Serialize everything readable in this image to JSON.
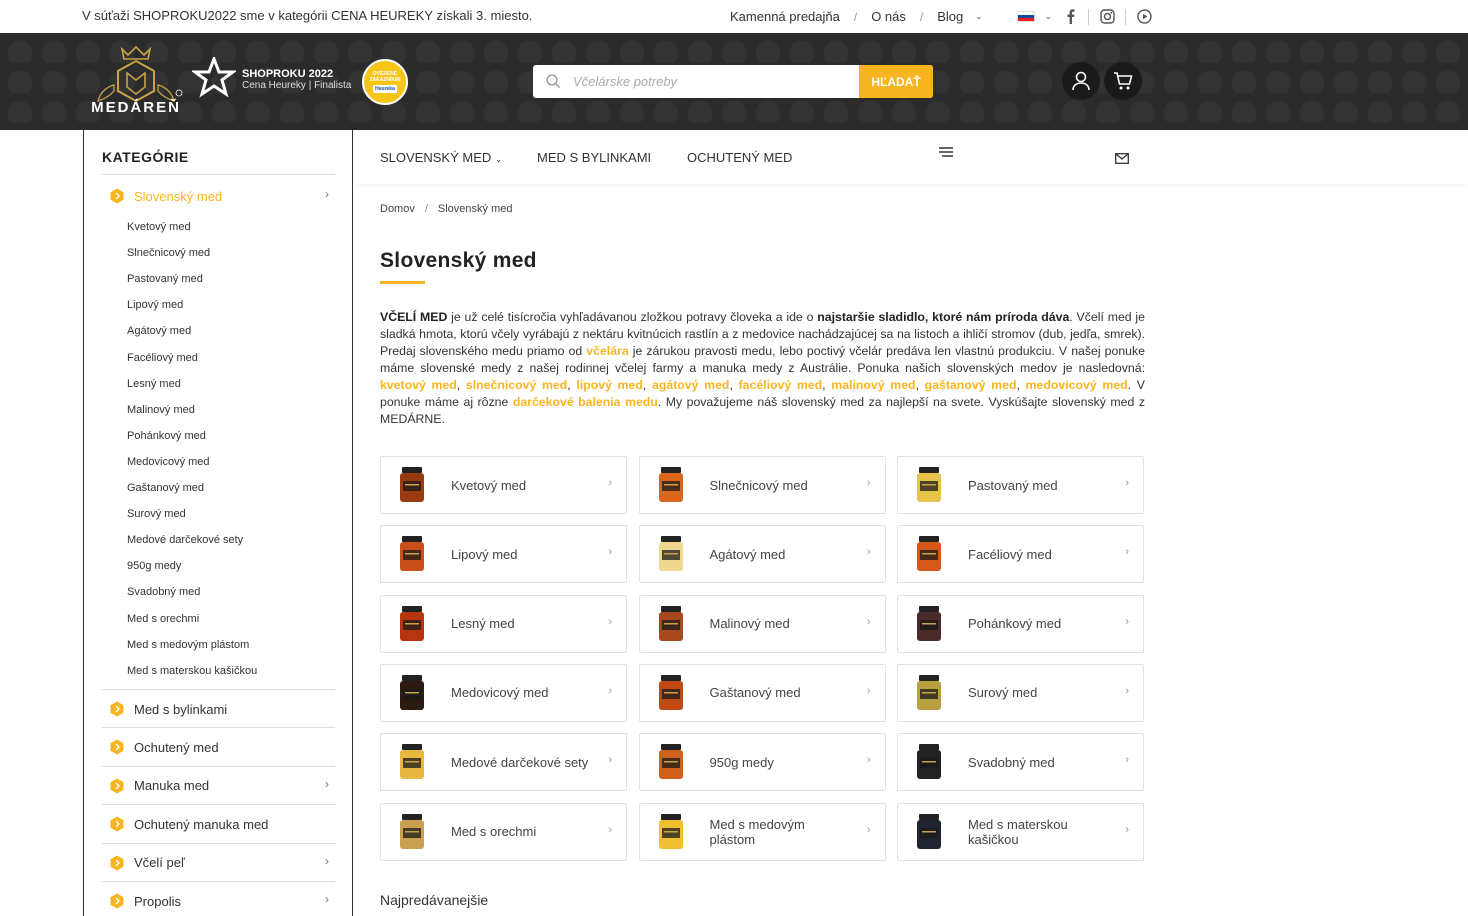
{
  "topbar": {
    "announcement": "V súťaži SHOPROKU2022 sme v kategórii CENA HEUREKY získali 3. miesto.",
    "links": [
      "Kamenná predajňa",
      "O nás",
      "Blog"
    ]
  },
  "header": {
    "logo_text": "MEDÁREŇ",
    "shoproku_title": "SHOPROKU 2022",
    "shoproku_sub": "Cena Heureky | Finalista",
    "badge_text": "OVERENÉ ZÁKAZNÍKMI",
    "badge_brand": "Heureka",
    "search_placeholder": "Včelárske potreby",
    "search_button": "HĽADAŤ"
  },
  "nav": {
    "items": [
      "SLOVENSKÝ MED",
      "MED S BYLINKAMI",
      "OCHUTENÝ MED"
    ]
  },
  "sidebar": {
    "title": "KATEGÓRIE",
    "active": "Slovenský med",
    "subitems": [
      "Kvetový med",
      "Slnečnicový med",
      "Pastovaný med",
      "Lipový med",
      "Agátový med",
      "Facéliový med",
      "Lesný med",
      "Malinový med",
      "Pohánkový med",
      "Medovicový med",
      "Gaštanový med",
      "Surový med",
      "Medové darčekové sety",
      "950g medy",
      "Svadobný med",
      "Med s orechmi",
      "Med s medovým plástom",
      "Med s materskou kašičkou"
    ],
    "categories": [
      "Med s bylinkami",
      "Ochutený med",
      "Manuka med",
      "Ochutený manuka med",
      "Včelí peľ",
      "Propolis"
    ]
  },
  "breadcrumb": {
    "home": "Domov",
    "current": "Slovenský med"
  },
  "page_title": "Slovenský med",
  "description": {
    "p1": "VČELÍ MED",
    "p2": " je už celé tisícročia vyhľadávanou zložkou potravy človeka a ide o ",
    "p3": "najstaršie sladidlo, ktoré nám príroda dáva",
    "p4": ". Včelí med je sladká hmota, ktorú včely vyrábajú z nektáru kvitnúcich rastlín a z medovice nachádzajúcej sa na listoch a ihličí stromov (dub, jedľa, smrek). Predaj slovenského medu priamo od ",
    "p5": "včelára",
    "p6": " je zárukou pravosti medu, lebo poctivý včelár predáva len vlastnú produkciu. V našej ponuke máme slovenské medy z našej rodinnej včelej farmy a manuka medy z Austrálie. Ponuka našich slovenských medov je nasledovná: ",
    "l1": "kvetový med",
    "l2": "slnečnicový med",
    "l3": "lipový med",
    "l4": "agátový med",
    "l5": "facéliový med",
    "l6": "malinový med",
    "l7": "gaštanový med",
    "l8": "medovicový med",
    "p7": ". V ponuke máme aj rôzne ",
    "l9": "darčekové balenia medu",
    "p8": ". My považujeme náš slovenský med za najlepší na svete. Vyskúšajte slovenský med z MEDÁRNE."
  },
  "tiles": [
    {
      "name": "Kvetový med",
      "color": "#9a3a12"
    },
    {
      "name": "Slnečnicový med",
      "color": "#d9661a"
    },
    {
      "name": "Pastovaný med",
      "color": "#e8c24a"
    },
    {
      "name": "Lipový med",
      "color": "#c9501a"
    },
    {
      "name": "Agátový med",
      "color": "#f0d890"
    },
    {
      "name": "Facéliový med",
      "color": "#d4581a"
    },
    {
      "name": "Lesný med",
      "color": "#b8360f"
    },
    {
      "name": "Malinový med",
      "color": "#a8481e"
    },
    {
      "name": "Pohánkový med",
      "color": "#4a2a2a"
    },
    {
      "name": "Medovicový med",
      "color": "#2a1a10"
    },
    {
      "name": "Gaštanový med",
      "color": "#c04a14"
    },
    {
      "name": "Surový med",
      "color": "#b8a040"
    },
    {
      "name": "Medové darčekové sety",
      "color": "#e8b840"
    },
    {
      "name": "950g medy",
      "color": "#d0601a"
    },
    {
      "name": "Svadobný med",
      "color": "#222222"
    },
    {
      "name": "Med s orechmi",
      "color": "#c8a050"
    },
    {
      "name": "Med s medovým plástom",
      "color": "#f0c030"
    },
    {
      "name": "Med s materskou kašičkou",
      "color": "#1f2530"
    }
  ],
  "bestsellers": "Najpredávanejšie",
  "colors": {
    "accent": "#f9b51f",
    "header_bg": "#2b2b2b"
  }
}
